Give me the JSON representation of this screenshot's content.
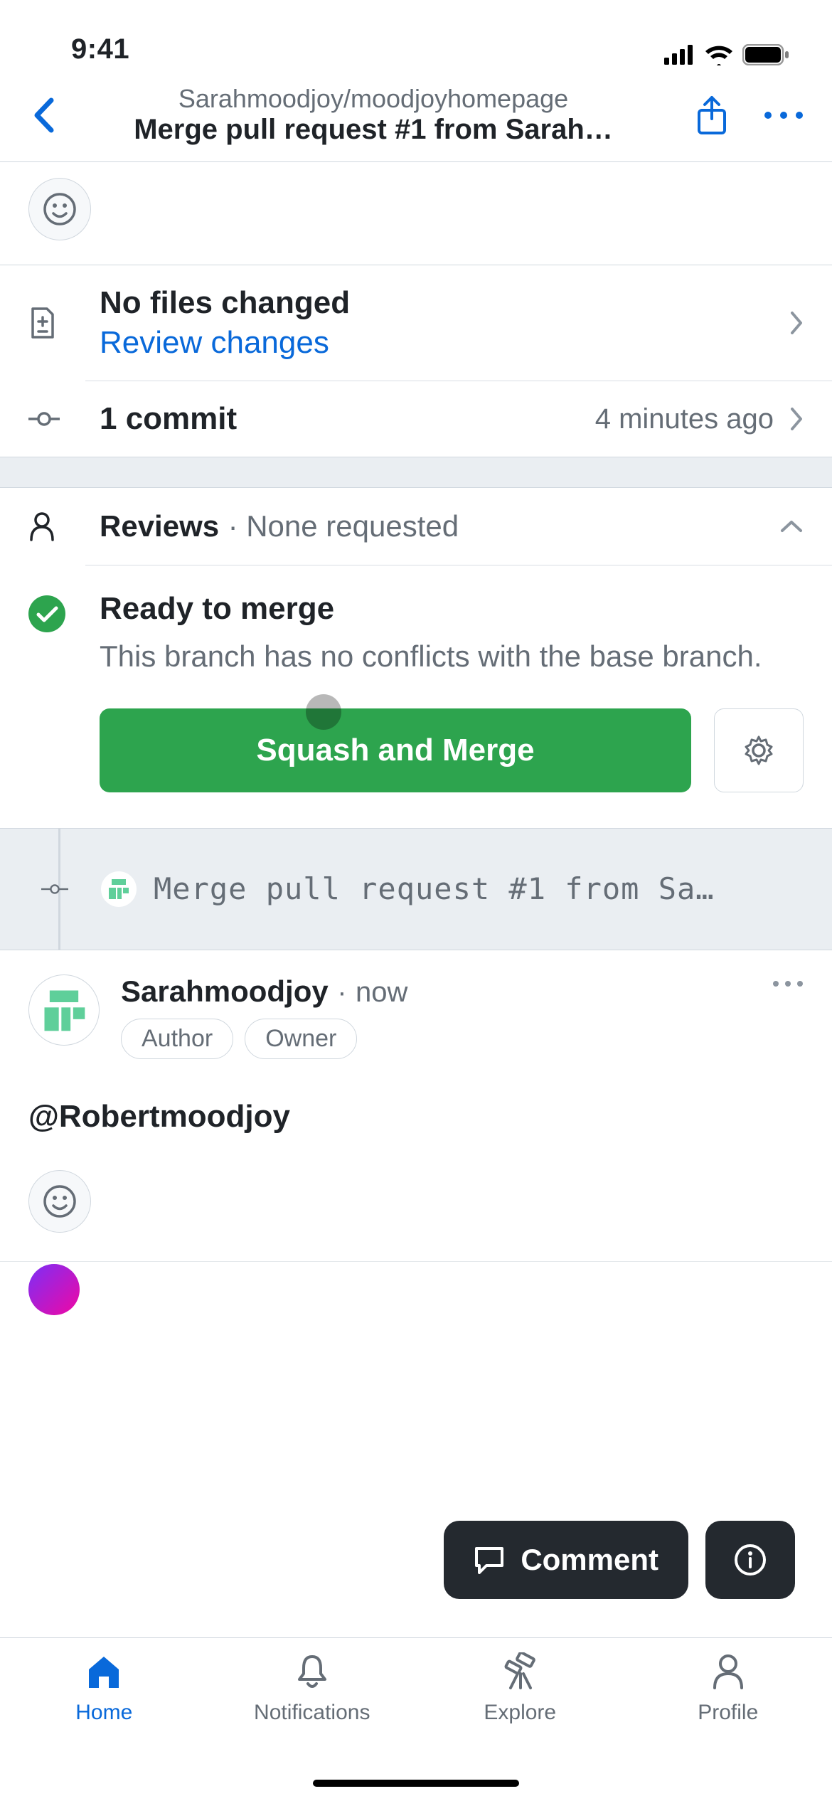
{
  "status": {
    "time": "9:41"
  },
  "header": {
    "repo": "Sarahmoodjoy/moodjoyhomepage",
    "title": "Merge pull request #1 from Sarah…"
  },
  "files": {
    "title": "No files changed",
    "review_link": "Review changes"
  },
  "commits": {
    "title": "1 commit",
    "time": "4 minutes ago"
  },
  "reviews": {
    "title": "Reviews",
    "status": "· None requested"
  },
  "merge": {
    "title": "Ready to merge",
    "description": "This branch has no conflicts with the base branch.",
    "button_label": "Squash and Merge"
  },
  "timeline": {
    "message": "Merge pull request #1 from Sa…"
  },
  "comment": {
    "author": "Sarahmoodjoy",
    "time_prefix": "·",
    "time": "now",
    "badges": [
      "Author",
      "Owner"
    ],
    "body": "@Robertmoodjoy"
  },
  "floaters": {
    "comment_label": "Comment"
  },
  "tabs": {
    "home": "Home",
    "notifications": "Notifications",
    "explore": "Explore",
    "profile": "Profile"
  }
}
